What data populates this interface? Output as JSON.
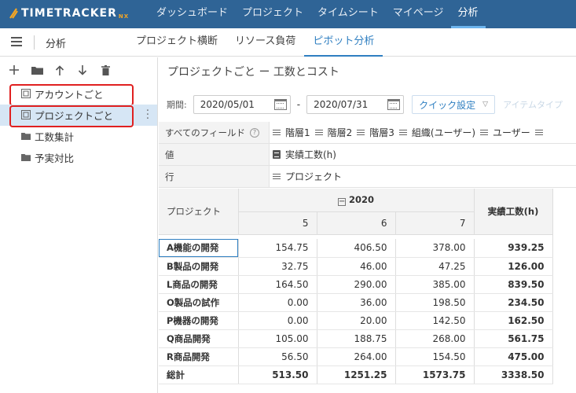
{
  "app": {
    "logo_text": "TIMETRACKER",
    "logo_suffix": "NX"
  },
  "nav": {
    "items": [
      {
        "label": "ダッシュボード",
        "active": false
      },
      {
        "label": "プロジェクト",
        "active": false
      },
      {
        "label": "タイムシート",
        "active": false
      },
      {
        "label": "マイページ",
        "active": false
      },
      {
        "label": "分析",
        "active": true
      }
    ]
  },
  "subbar": {
    "title": "分析",
    "tabs": [
      {
        "label": "プロジェクト横断",
        "active": false
      },
      {
        "label": "リソース負荷",
        "active": false
      },
      {
        "label": "ピボット分析",
        "active": true
      }
    ]
  },
  "toolbar": {
    "icons": [
      "add-icon",
      "folder-icon",
      "arrow-up-icon",
      "arrow-down-icon",
      "trash-icon"
    ]
  },
  "tree": {
    "items": [
      {
        "label": "アカウントごと",
        "icon": "report-icon",
        "selected": false,
        "highlighted": true
      },
      {
        "label": "プロジェクトごと",
        "icon": "report-icon",
        "selected": true,
        "highlighted": true
      },
      {
        "label": "工数集計",
        "icon": "folder-icon",
        "selected": false,
        "highlighted": false
      },
      {
        "label": "予実対比",
        "icon": "folder-icon",
        "selected": false,
        "highlighted": false
      }
    ]
  },
  "content": {
    "title": "プロジェクトごと ー 工数とコスト",
    "period_label": "期間:",
    "date_from": "2020/05/01",
    "date_separator": "-",
    "date_to": "2020/07/31",
    "quick_setting": "クイック設定",
    "item_type": "アイテムタイプ"
  },
  "fields": {
    "all_label": "すべてのフィールド",
    "all_chips": [
      "階層1",
      "階層2",
      "階層3",
      "組織(ユーザー)",
      "ユーザー"
    ],
    "values_label": "値",
    "values_chip": "実績工数(h)",
    "rows_label": "行",
    "rows_chip": "プロジェクト"
  },
  "pivot": {
    "row_header": "プロジェクト",
    "year": "2020",
    "months": [
      "5",
      "6",
      "7"
    ],
    "total_header": "実績工数(h)",
    "rows": [
      {
        "label": "A機能の開発",
        "values": [
          "154.75",
          "406.50",
          "378.00"
        ],
        "total": "939.25"
      },
      {
        "label": "B製品の開発",
        "values": [
          "32.75",
          "46.00",
          "47.25"
        ],
        "total": "126.00"
      },
      {
        "label": "L商品の開発",
        "values": [
          "164.50",
          "290.00",
          "385.00"
        ],
        "total": "839.50"
      },
      {
        "label": "O製品の試作",
        "values": [
          "0.00",
          "36.00",
          "198.50"
        ],
        "total": "234.50"
      },
      {
        "label": "P機器の開発",
        "values": [
          "0.00",
          "20.00",
          "142.50"
        ],
        "total": "162.50"
      },
      {
        "label": "Q商品開発",
        "values": [
          "105.00",
          "188.75",
          "268.00"
        ],
        "total": "561.75"
      },
      {
        "label": "R商品開発",
        "values": [
          "56.50",
          "264.00",
          "154.50"
        ],
        "total": "475.00"
      }
    ],
    "grand": {
      "label": "総計",
      "values": [
        "513.50",
        "1251.25",
        "1573.75"
      ],
      "total": "3338.50"
    }
  }
}
